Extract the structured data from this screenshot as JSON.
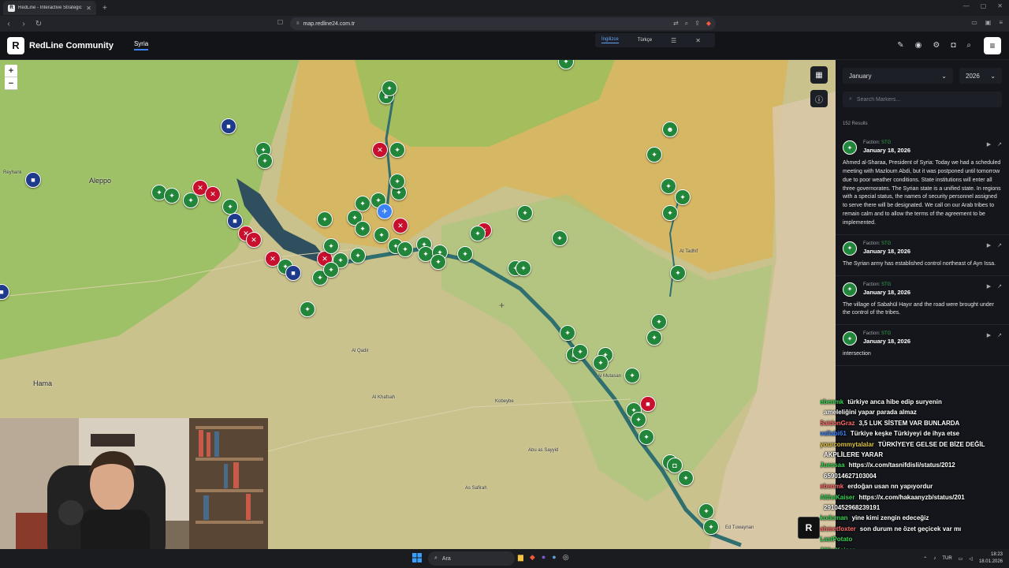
{
  "browser": {
    "tab_title": "RedLine - Interactive Strategic M",
    "url": "map.redline24.com.tr"
  },
  "header": {
    "brand": "RedLine Community",
    "country_tab": "Syria",
    "lang_en": "İngilizce",
    "lang_tr": "Türkçe"
  },
  "filters": {
    "month": "January",
    "year": "2026",
    "search_placeholder": "Search Markers...",
    "results": "152 Results"
  },
  "map_labels": {
    "aleppo": "Aleppo",
    "hama": "Hama",
    "reyhanli": "Reyhanlı",
    "al_qadir": "Al Qadir",
    "abu_sayyid": "Abu as Sayyid",
    "kobeybe": "Kobeybe",
    "al_khafsah": "Al Khafsah",
    "deir": "Al Mutasan",
    "safirah": "As Safirah",
    "tadhif": "At Tadhif",
    "ed_tuwaynan": "Ed Tuwaynan"
  },
  "events": [
    {
      "faction_label": "Faction:",
      "faction": "STG",
      "date": "January 18, 2026",
      "text": "Ahmed al-Sharaa, President of Syria: Today we had a scheduled meeting with Mazloum Abdi, but it was postponed until tomorrow due to poor weather conditions. State institutions will enter all three governorates. The Syrian state is a unified state. In regions with a special status, the names of security personnel assigned to serve there will be designated. We call on our Arab tribes to remain calm and to allow the terms of the agreement to be implemented."
    },
    {
      "faction_label": "Faction:",
      "faction": "STG",
      "date": "January 18, 2026",
      "text": "The Syrian army has established control northeast of Ayn Issa."
    },
    {
      "faction_label": "Faction:",
      "faction": "STG",
      "date": "January 18, 2026",
      "text": "The village of Sabahül Hayır and the road were brought under the control of the tribes."
    },
    {
      "faction_label": "Faction:",
      "faction": "STG",
      "date": "January 18, 2026",
      "text": "intersection"
    }
  ],
  "chat": [
    {
      "user": "ebenmk",
      "color": "#39d353",
      "msg": "türkiye anca hibe edip suryenin"
    },
    {
      "user": "",
      "color": "#ffffff",
      "msg": "ameleliğini yapar parada almaz"
    },
    {
      "user": "SaidonGraz",
      "color": "#ff6b6b",
      "msg": "3,5 LUK SİSTEM VAR BUNLARDA"
    },
    {
      "user": "vallabi61",
      "color": "#3b82f6",
      "msg": "Türkiye keşke Türkiyeyi de ihya etse"
    },
    {
      "user": "yourcommytalalar",
      "color": "#e0c341",
      "msg": "TÜRKİYEYE GELSE DE BİZE DEĞİL"
    },
    {
      "user": "",
      "color": "#ffffff",
      "msg": "AKPLİLERE YARAR"
    },
    {
      "user": "Juessaa",
      "color": "#39d353",
      "msg": "https://x.com/tasnifdisli/status/2012"
    },
    {
      "user": "",
      "color": "#ffffff",
      "msg": "659014627103004"
    },
    {
      "user": "ebenmk",
      "color": "#ff6b6b",
      "msg": "erdoğan usan nn yapıyordur"
    },
    {
      "user": "AltheKaiser",
      "color": "#39d353",
      "msg": "https://x.com/hakaanyzb/status/201"
    },
    {
      "user": "",
      "color": "#ffffff",
      "msg": "2910452968239191"
    },
    {
      "user": "kodoman",
      "color": "#39d353",
      "msg": "yine kimi zengin edeceğiz"
    },
    {
      "user": "ahmetfoxter",
      "color": "#ff6b6b",
      "msg": "son durum ne özet geçicek var mı"
    },
    {
      "user": "LastPotato",
      "color": "#39d353",
      "msg": ""
    },
    {
      "user": "AltheKaiser",
      "color": "#39d353",
      "msg": ""
    }
  ],
  "taskbar": {
    "search": "Ara",
    "lang": "TUR",
    "time": "18:23",
    "date": "18.01.2026"
  },
  "colors": {
    "accent": "#3b82f6",
    "faction_green": "#22863a",
    "hostile_red": "#c8102e",
    "sdf_zone": "#d9b45a",
    "gov_zone": "#8fbf5a"
  }
}
